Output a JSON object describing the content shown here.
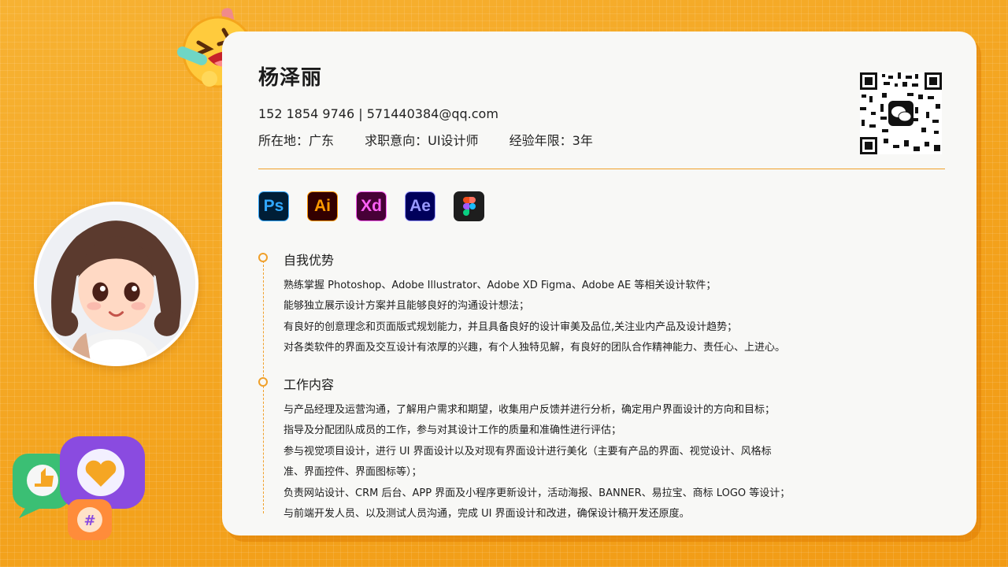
{
  "profile": {
    "name": "杨泽丽",
    "contact": "152 1854 9746 | 571440384@qq.com",
    "location": "所在地：广东",
    "intention": "求职意向：UI设计师",
    "experience": "经验年限：3年"
  },
  "tools": [
    {
      "label": "Ps",
      "icon": "photoshop-icon"
    },
    {
      "label": "Ai",
      "icon": "illustrator-icon"
    },
    {
      "label": "Xd",
      "icon": "xd-icon"
    },
    {
      "label": "Ae",
      "icon": "after-effects-icon"
    },
    {
      "label": "",
      "icon": "figma-icon"
    }
  ],
  "sections": [
    {
      "title": "自我优势",
      "lines": [
        "熟练掌握 Photoshop、Adobe Illustrator、Adobe XD Figma、Adobe AE 等相关设计软件；",
        "能够独立展示设计方案并且能够良好的沟通设计想法；",
        "有良好的创意理念和页面版式规划能力，并且具备良好的设计审美及品位,关注业内产品及设计趋势；",
        "对各类软件的界面及交互设计有浓厚的兴趣，有个人独特见解，有良好的团队合作精神能力、责任心、上进心。"
      ]
    },
    {
      "title": "工作内容",
      "lines": [
        "与产品经理及运营沟通，了解用户需求和期望，收集用户反馈并进行分析，确定用户界面设计的方向和目标；",
        "指导及分配团队成员的工作，参与对其设计工作的质量和准确性进行评估；",
        "参与视觉项目设计，进行 UI 界面设计以及对现有界面设计进行美化（主要有产品的界面、视觉设计、风格标",
        "准、界面控件、界面图标等）；",
        "负责网站设计、CRM 后台、APP 界面及小程序更新设计，活动海报、BANNER、易拉宝、商标 LOGO 等设计；",
        "与前端开发人员、以及测试人员沟通，完成 UI 界面设计和改进，确保设计稿开发还原度。"
      ]
    }
  ],
  "colors": {
    "background": "#f5a623",
    "accent": "#f0a02a",
    "card": "#f8f8f6"
  }
}
